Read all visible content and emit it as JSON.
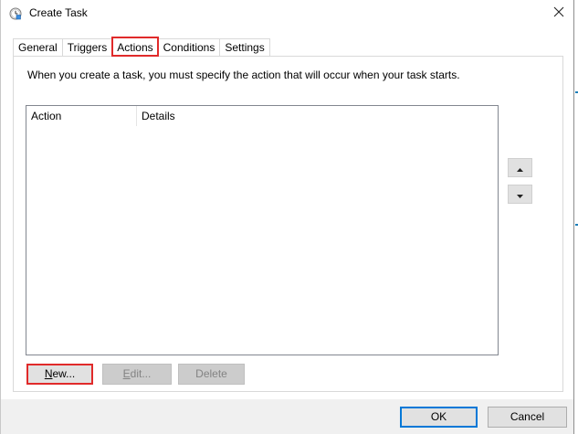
{
  "window": {
    "title": "Create Task"
  },
  "tabs": [
    {
      "label": "General",
      "active": false
    },
    {
      "label": "Triggers",
      "active": false
    },
    {
      "label": "Actions",
      "active": true
    },
    {
      "label": "Conditions",
      "active": false
    },
    {
      "label": "Settings",
      "active": false
    }
  ],
  "actions_tab": {
    "intro": "When you create a task, you must specify the action that will occur when your task starts.",
    "columns": {
      "action": "Action",
      "details": "Details"
    },
    "rows": []
  },
  "buttons": {
    "new": {
      "label": "New...",
      "mnemonic": "N",
      "rest": "ew..."
    },
    "edit": {
      "label": "Edit...",
      "mnemonic": "E",
      "rest": "dit..."
    },
    "delete": {
      "label": "Delete"
    },
    "ok": {
      "label": "OK"
    },
    "cancel": {
      "label": "Cancel"
    }
  },
  "icons": {
    "title": "task-clock-icon",
    "close": "close-icon",
    "move_up": "arrow-up-icon",
    "move_down": "arrow-down-icon"
  },
  "colors": {
    "highlight": "#e02a2a",
    "accent": "#0078d7",
    "button_face": "#e1e1e1",
    "footer": "#f0f0f0"
  }
}
